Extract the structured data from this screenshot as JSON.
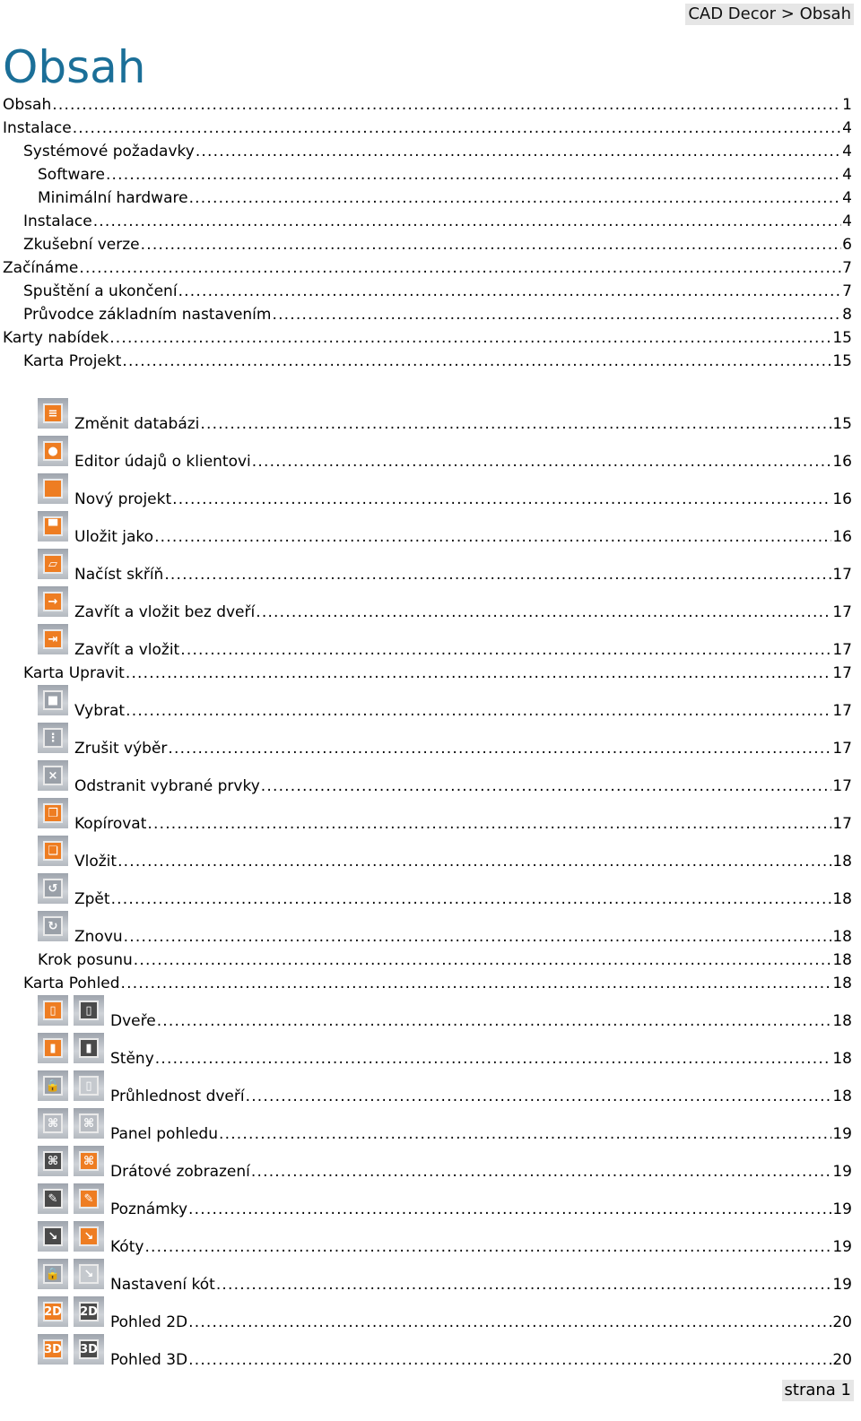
{
  "header": {
    "breadcrumb": "CAD Decor > Obsah"
  },
  "title": "Obsah",
  "footer": {
    "page_label": "strana 1"
  },
  "colors": {
    "title": "#1b6f98",
    "icon_orange": "#ee7d22",
    "icon_dark": "#4a4a4a"
  },
  "toc": [
    {
      "text": "Obsah",
      "page": "1",
      "level": 0
    },
    {
      "text": "Instalace",
      "page": "4",
      "level": 0
    },
    {
      "text": "Systémové požadavky",
      "page": "4",
      "level": 1
    },
    {
      "text": "Software",
      "page": "4",
      "level": 2
    },
    {
      "text": "Minimální hardware",
      "page": "4",
      "level": 2
    },
    {
      "text": "Instalace",
      "page": "4",
      "level": 1
    },
    {
      "text": "Zkušební verze",
      "page": "6",
      "level": 1
    },
    {
      "text": "Začínáme",
      "page": "7",
      "level": 0
    },
    {
      "text": "Spuštění a ukončení",
      "page": "7",
      "level": 1
    },
    {
      "text": "Průvodce základním nastavením",
      "page": "8",
      "level": 1
    },
    {
      "text": "Karty nabídek",
      "page": "15",
      "level": 0
    },
    {
      "text": "Karta Projekt",
      "page": "15",
      "level": 1
    },
    {
      "text": "Změnit databázi",
      "page": "15",
      "level": 2,
      "gap": true,
      "icons": [
        {
          "name": "database-icon",
          "color": "#ee7d22",
          "glyph": "≡"
        }
      ]
    },
    {
      "text": "Editor údajů o klientovi",
      "page": "16",
      "level": 2,
      "icons": [
        {
          "name": "client-icon",
          "color": "#ee7d22",
          "glyph": "●"
        }
      ]
    },
    {
      "text": "Nový projekt",
      "page": "16",
      "level": 2,
      "icons": [
        {
          "name": "new-project-icon",
          "color": "#ee7d22",
          "glyph": ""
        }
      ]
    },
    {
      "text": "Uložit jako",
      "page": "16",
      "level": 2,
      "icons": [
        {
          "name": "save-icon",
          "color": "#ee7d22",
          "glyph": "▀"
        }
      ]
    },
    {
      "text": "Načíst skříň",
      "page": "17",
      "level": 2,
      "icons": [
        {
          "name": "folder-icon",
          "color": "#ee7d22",
          "glyph": "▱"
        }
      ]
    },
    {
      "text": "Zavřít a vložit bez dveří",
      "page": "17",
      "level": 2,
      "icons": [
        {
          "name": "arrow-right-icon",
          "color": "#ee7d22",
          "glyph": "→"
        }
      ]
    },
    {
      "text": "Zavřít a vložit",
      "page": "17",
      "level": 2,
      "icons": [
        {
          "name": "insert-icon",
          "color": "#ee7d22",
          "glyph": "⇥"
        }
      ]
    },
    {
      "text": "Karta Upravit",
      "page": "17",
      "level": 1
    },
    {
      "text": "Vybrat",
      "page": "17",
      "level": 2,
      "icons": [
        {
          "name": "select-grid-icon",
          "color": "#9aa0a8",
          "glyph": "■"
        }
      ]
    },
    {
      "text": "Zrušit výběr",
      "page": "17",
      "level": 2,
      "icons": [
        {
          "name": "deselect-grid-icon",
          "color": "#9aa0a8",
          "glyph": "⋮"
        }
      ]
    },
    {
      "text": "Odstranit vybrané prvky",
      "page": "17",
      "level": 2,
      "icons": [
        {
          "name": "delete-grid-icon",
          "color": "#9aa0a8",
          "glyph": "×"
        }
      ]
    },
    {
      "text": "Kopírovat",
      "page": "17",
      "level": 2,
      "icons": [
        {
          "name": "copy-icon",
          "color": "#ee7d22",
          "glyph": "❐"
        }
      ]
    },
    {
      "text": "Vložit",
      "page": "18",
      "level": 2,
      "icons": [
        {
          "name": "paste-icon",
          "color": "#ee7d22",
          "glyph": "❏"
        }
      ]
    },
    {
      "text": "Zpět",
      "page": "18",
      "level": 2,
      "icons": [
        {
          "name": "undo-icon",
          "color": "#9aa0a8",
          "glyph": "↺"
        }
      ]
    },
    {
      "text": "Znovu",
      "page": "18",
      "level": 2,
      "icons": [
        {
          "name": "redo-icon",
          "color": "#9aa0a8",
          "glyph": "↻"
        }
      ]
    },
    {
      "text": "Krok posunu",
      "page": "18",
      "level": 2
    },
    {
      "text": "Karta Pohled",
      "page": "18",
      "level": 1
    },
    {
      "text": "Dveře",
      "page": "18",
      "level": 2,
      "icons": [
        {
          "name": "door-orange-icon",
          "color": "#ee7d22",
          "glyph": "▯"
        },
        {
          "name": "door-dark-icon",
          "color": "#4a4a4a",
          "glyph": "▯"
        }
      ]
    },
    {
      "text": "Stěny",
      "page": "18",
      "level": 2,
      "icons": [
        {
          "name": "walls-orange-icon",
          "color": "#ee7d22",
          "glyph": "▮"
        },
        {
          "name": "walls-dark-icon",
          "color": "#4a4a4a",
          "glyph": "▮"
        }
      ]
    },
    {
      "text": "Průhlednost dveří",
      "page": "18",
      "level": 2,
      "icons": [
        {
          "name": "door-lock-icon",
          "color": "#9aa0a8",
          "glyph": "🔒"
        },
        {
          "name": "door-transparent-icon",
          "color": "#c5c9ce",
          "glyph": "▯"
        }
      ]
    },
    {
      "text": "Panel pohledu",
      "page": "19",
      "level": 2,
      "icons": [
        {
          "name": "view-panel-gray-icon",
          "color": "#b8bcc2",
          "glyph": "⌘"
        },
        {
          "name": "view-panel-orange-icon",
          "color": "#b8bcc2",
          "glyph": "⌘"
        }
      ]
    },
    {
      "text": "Drátové zobrazení",
      "page": "19",
      "level": 2,
      "icons": [
        {
          "name": "wireframe-dark-icon",
          "color": "#4a4a4a",
          "glyph": "⌘"
        },
        {
          "name": "wireframe-orange-icon",
          "color": "#ee7d22",
          "glyph": "⌘"
        }
      ]
    },
    {
      "text": "Poznámky",
      "page": "19",
      "level": 2,
      "icons": [
        {
          "name": "notes-dark-icon",
          "color": "#4a4a4a",
          "glyph": "✎"
        },
        {
          "name": "notes-orange-icon",
          "color": "#ee7d22",
          "glyph": "✎"
        }
      ]
    },
    {
      "text": "Kóty",
      "page": "19",
      "level": 2,
      "icons": [
        {
          "name": "dimensions-dark-icon",
          "color": "#4a4a4a",
          "glyph": "↘"
        },
        {
          "name": "dimensions-orange-icon",
          "color": "#ee7d22",
          "glyph": "↘"
        }
      ]
    },
    {
      "text": "Nastavení kót",
      "page": "19",
      "level": 2,
      "icons": [
        {
          "name": "dimension-lock-icon",
          "color": "#9aa0a8",
          "glyph": "🔒"
        },
        {
          "name": "dimension-light-icon",
          "color": "#c5c9ce",
          "glyph": "↘"
        }
      ]
    },
    {
      "text": "Pohled 2D",
      "page": "20",
      "level": 2,
      "icons": [
        {
          "name": "view-2d-orange-icon",
          "color": "#ee7d22",
          "glyph": "2D"
        },
        {
          "name": "view-2d-dark-icon",
          "color": "#4a4a4a",
          "glyph": "2D"
        }
      ]
    },
    {
      "text": "Pohled 3D",
      "page": "20",
      "level": 2,
      "icons": [
        {
          "name": "view-3d-orange-icon",
          "color": "#ee7d22",
          "glyph": "3D"
        },
        {
          "name": "view-3d-dark-icon",
          "color": "#4a4a4a",
          "glyph": "3D"
        }
      ]
    }
  ]
}
